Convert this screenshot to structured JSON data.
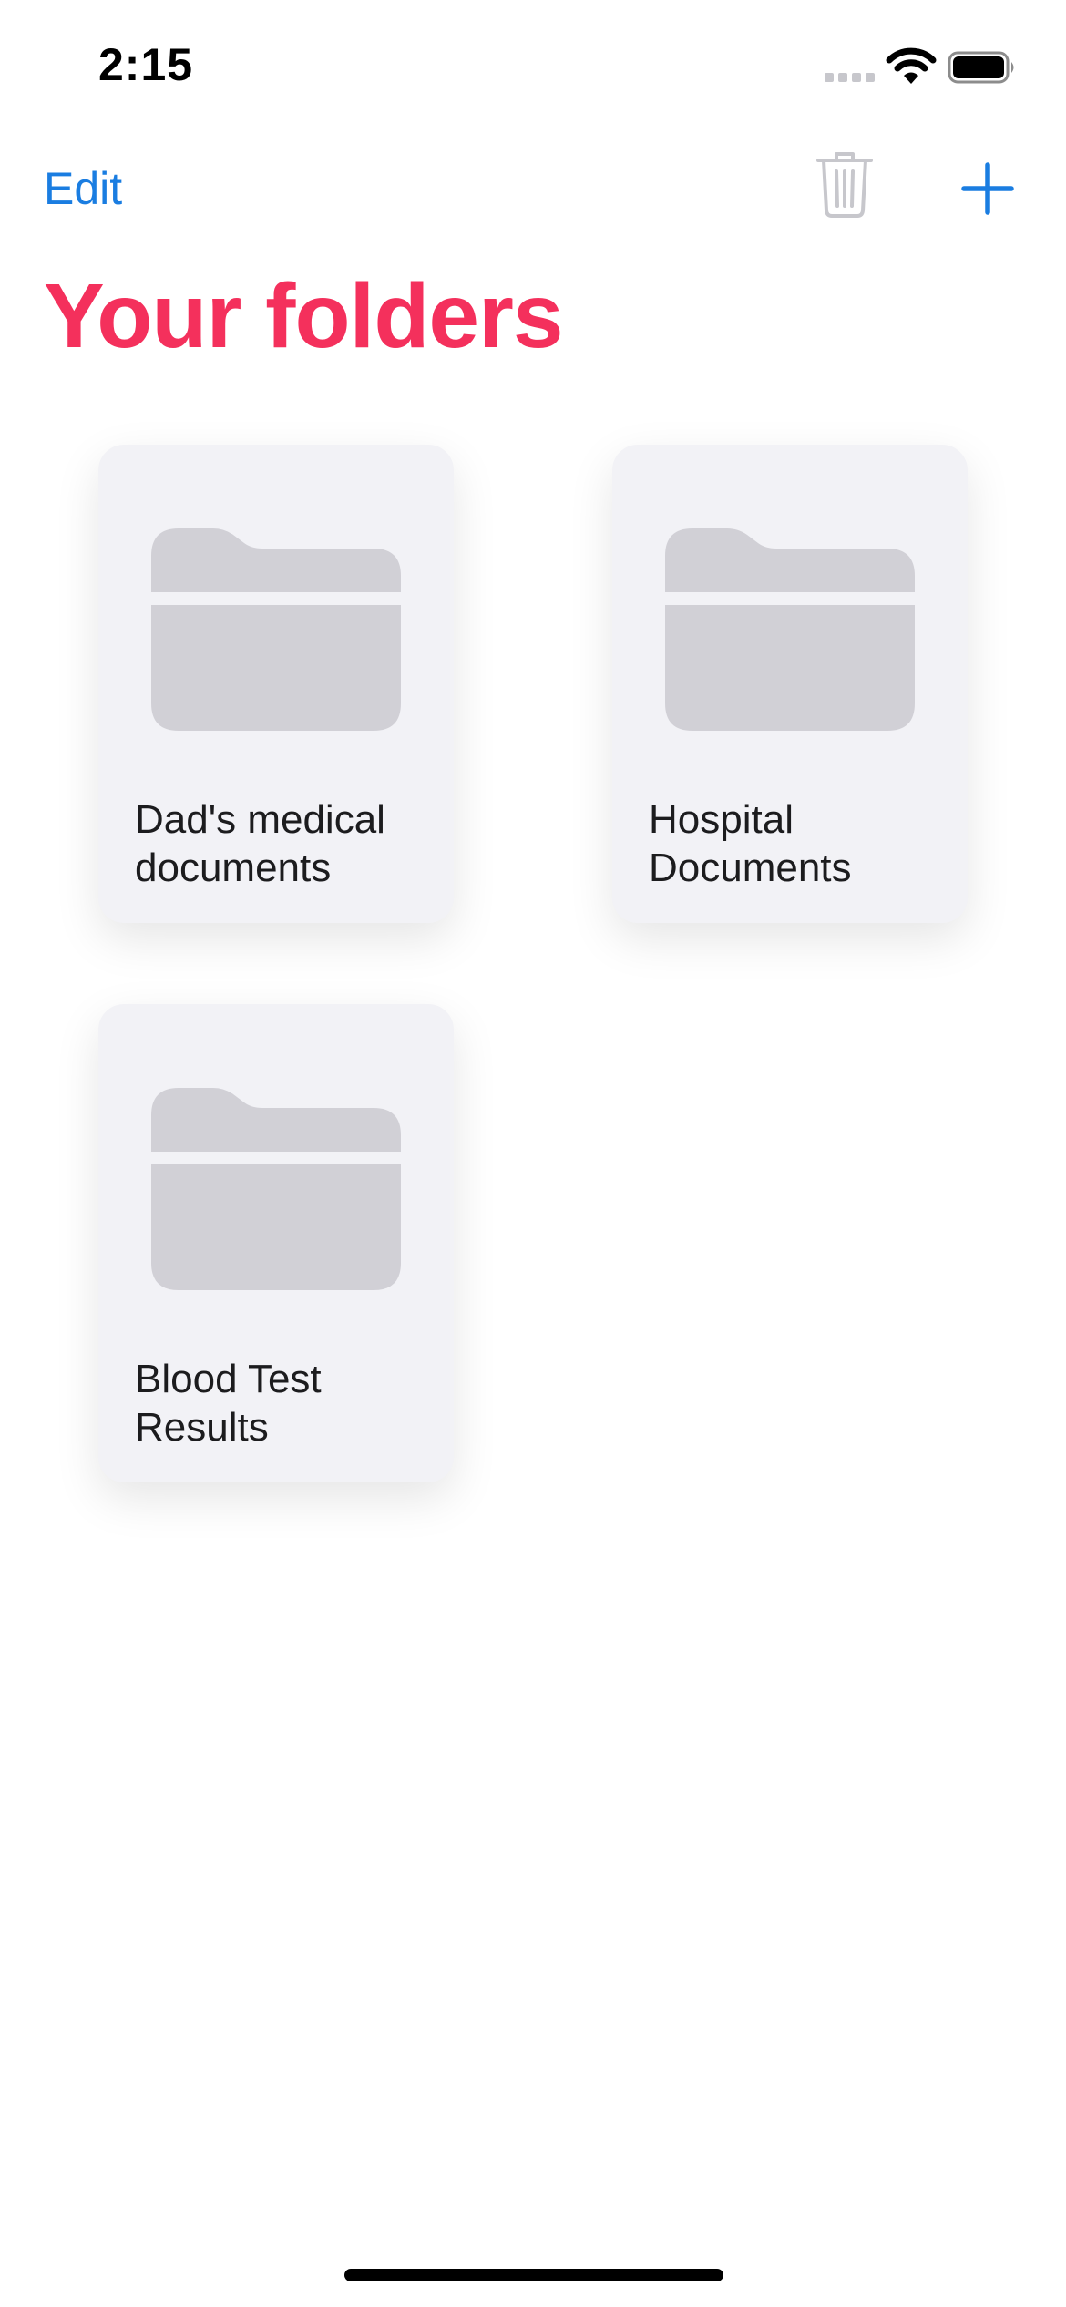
{
  "status_bar": {
    "time": "2:15"
  },
  "nav": {
    "edit_label": "Edit",
    "trash_icon": "trash-icon",
    "add_icon": "plus-icon"
  },
  "page": {
    "title": "Your folders"
  },
  "folders": [
    {
      "name": "Dad's medical documents"
    },
    {
      "name": "Hospital Documents"
    },
    {
      "name": "Blood Test Results"
    }
  ],
  "colors": {
    "accent": "#1a7de1",
    "title": "#f4305c",
    "card_background": "#f2f2f6",
    "folder_icon": "#d1d0d6",
    "trash_disabled": "#c7c7cc"
  }
}
